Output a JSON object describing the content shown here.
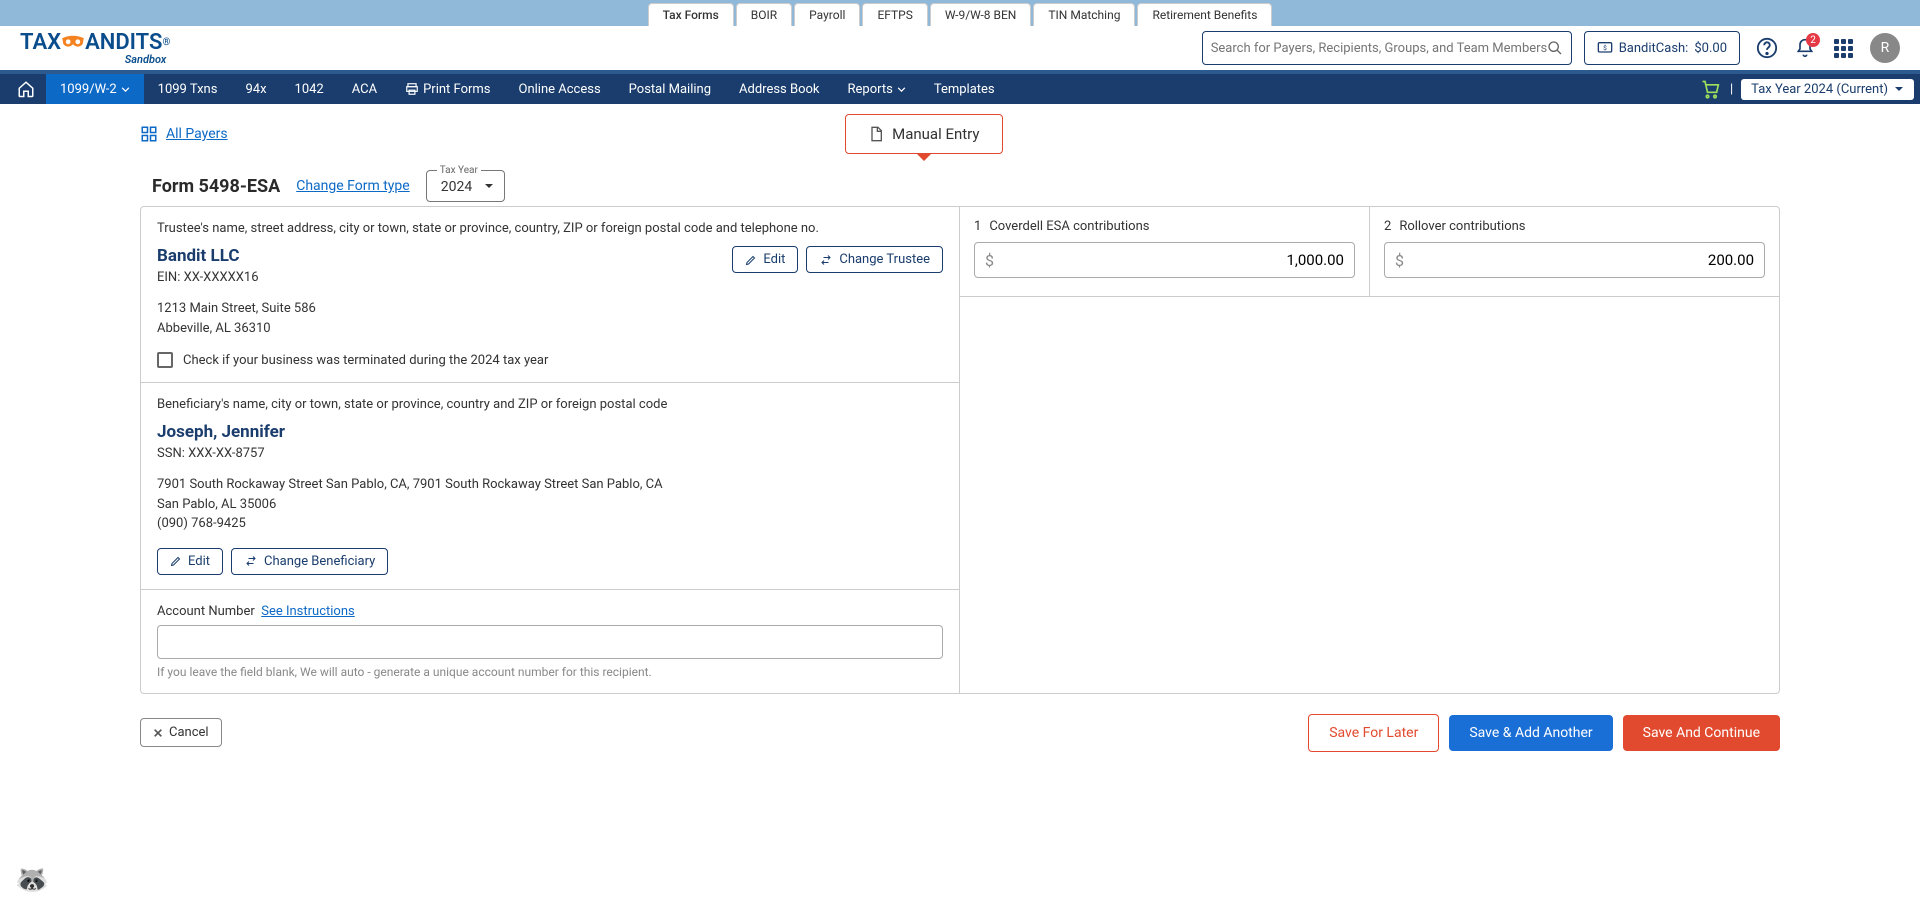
{
  "topTabs": [
    "Tax Forms",
    "BOIR",
    "Payroll",
    "EFTPS",
    "W-9/W-8 BEN",
    "TIN Matching",
    "Retirement Benefits"
  ],
  "activeTopTab": 0,
  "brand": {
    "name": "TAX",
    "name2": "ANDITS",
    "sub": "Sandbox",
    "reg": "®"
  },
  "search": {
    "placeholder": "Search for Payers, Recipients, Groups, and Team Members"
  },
  "banditCash": {
    "label": "BanditCash:",
    "amount": "$0.00"
  },
  "notifCount": "2",
  "avatarLetter": "R",
  "nav": {
    "items": [
      "1099/W-2",
      "1099 Txns",
      "94x",
      "1042",
      "ACA",
      "Print Forms",
      "Online Access",
      "Postal Mailing",
      "Address Book",
      "Reports",
      "Templates"
    ],
    "activeIndex": 0,
    "taxYear": "Tax Year 2024 (Current)"
  },
  "page": {
    "allPayers": "All Payers",
    "entryTab": "Manual Entry",
    "formTitle": "Form 5498-ESA",
    "changeFormType": "Change Form type",
    "yearSelect": {
      "label": "Tax Year",
      "value": "2024"
    }
  },
  "trustee": {
    "sectionLabel": "Trustee's name, street address, city or town, state or province, country, ZIP or foreign postal code and telephone no.",
    "name": "Bandit LLC",
    "ein": "EIN: XX-XXXXX16",
    "addr1": "1213 Main Street, Suite 586",
    "addr2": "Abbeville, AL 36310",
    "editBtn": "Edit",
    "changeBtn": "Change Trustee",
    "checkboxLabel": "Check if your business was terminated during the 2024 tax year"
  },
  "beneficiary": {
    "sectionLabel": "Beneficiary's name, city or town, state or province, country and ZIP or foreign postal code",
    "name": "Joseph, Jennifer",
    "ssn": "SSN: XXX-XX-8757",
    "addr1": "7901 South Rockaway Street San Pablo, CA, 7901 South Rockaway Street San Pablo, CA",
    "addr2": "San Pablo, AL 35006",
    "phone": "(090) 768-9425",
    "editBtn": "Edit",
    "changeBtn": "Change Beneficiary"
  },
  "account": {
    "label": "Account Number",
    "link": "See Instructions",
    "hint": "If you leave the field blank, We will auto - generate a unique account number for this recipient."
  },
  "fields": {
    "f1": {
      "num": "1",
      "label": "Coverdell ESA contributions",
      "value": "1,000.00"
    },
    "f2": {
      "num": "2",
      "label": "Rollover contributions",
      "value": "200.00"
    }
  },
  "footer": {
    "cancel": "Cancel",
    "saveLater": "Save For Later",
    "saveAdd": "Save & Add Another",
    "saveContinue": "Save And Continue"
  }
}
